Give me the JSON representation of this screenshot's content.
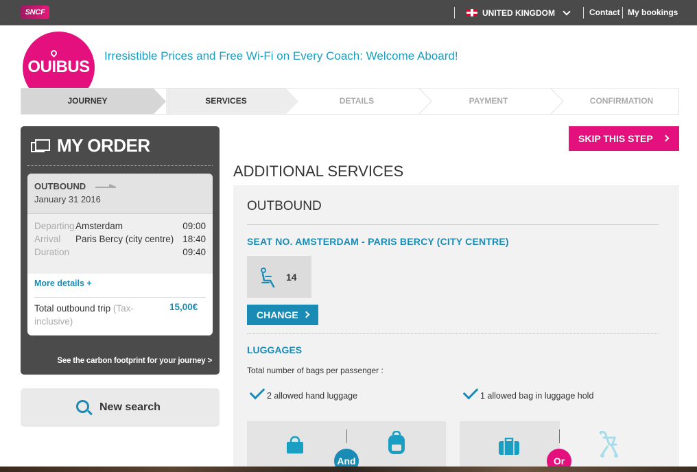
{
  "topbar": {
    "logo": "SNCF",
    "country": "UNITED KINGDOM",
    "contact": "Contact",
    "bookings": "My bookings"
  },
  "header": {
    "brand": "OUIBUS",
    "tagline": "Irresistible Prices and Free Wi-Fi on Every Coach: Welcome Aboard!"
  },
  "steps": [
    {
      "label": "JOURNEY",
      "state": "done"
    },
    {
      "label": "SERVICES",
      "state": "current"
    },
    {
      "label": "DETAILS",
      "state": "upcoming"
    },
    {
      "label": "PAYMENT",
      "state": "upcoming"
    },
    {
      "label": "CONFIRMATION",
      "state": "upcoming"
    }
  ],
  "order": {
    "title": "MY ORDER",
    "direction": "OUTBOUND",
    "date": "January 31 2016",
    "departing_label": "Departing",
    "departing_value": "Amsterdam",
    "departing_time": "09:00",
    "arrival_label": "Arrival",
    "arrival_value": "Paris Bercy (city centre)",
    "arrival_time": "18:40",
    "duration_label": "Duration",
    "duration_value": "09:40",
    "more_details": "More details +",
    "total_label": "Total outbound trip",
    "total_note": "(Tax-inclusive)",
    "total_price": "15,00€",
    "carbon_link": "See the carbon footprint for your journey >"
  },
  "new_search": "New search",
  "main": {
    "skip": "SKIP THIS STEP",
    "title": "ADDITIONAL SERVICES",
    "outbound": "OUTBOUND",
    "seat_title": "SEAT NO. AMSTERDAM - PARIS BERCY (CITY CENTRE)",
    "seat_number": "14",
    "change": "CHANGE",
    "luggage_title": "LUGGAGES",
    "luggage_sub": "Total number of bags per passenger :",
    "hand_luggage": "2 allowed hand luggage",
    "hold_luggage": "1 allowed bag in luggage hold",
    "and_label": "And",
    "or_label": "Or"
  },
  "colors": {
    "brand_pink": "#e3107d",
    "accent_blue": "#1a8bb5",
    "topbar": "#4a4a4a"
  }
}
